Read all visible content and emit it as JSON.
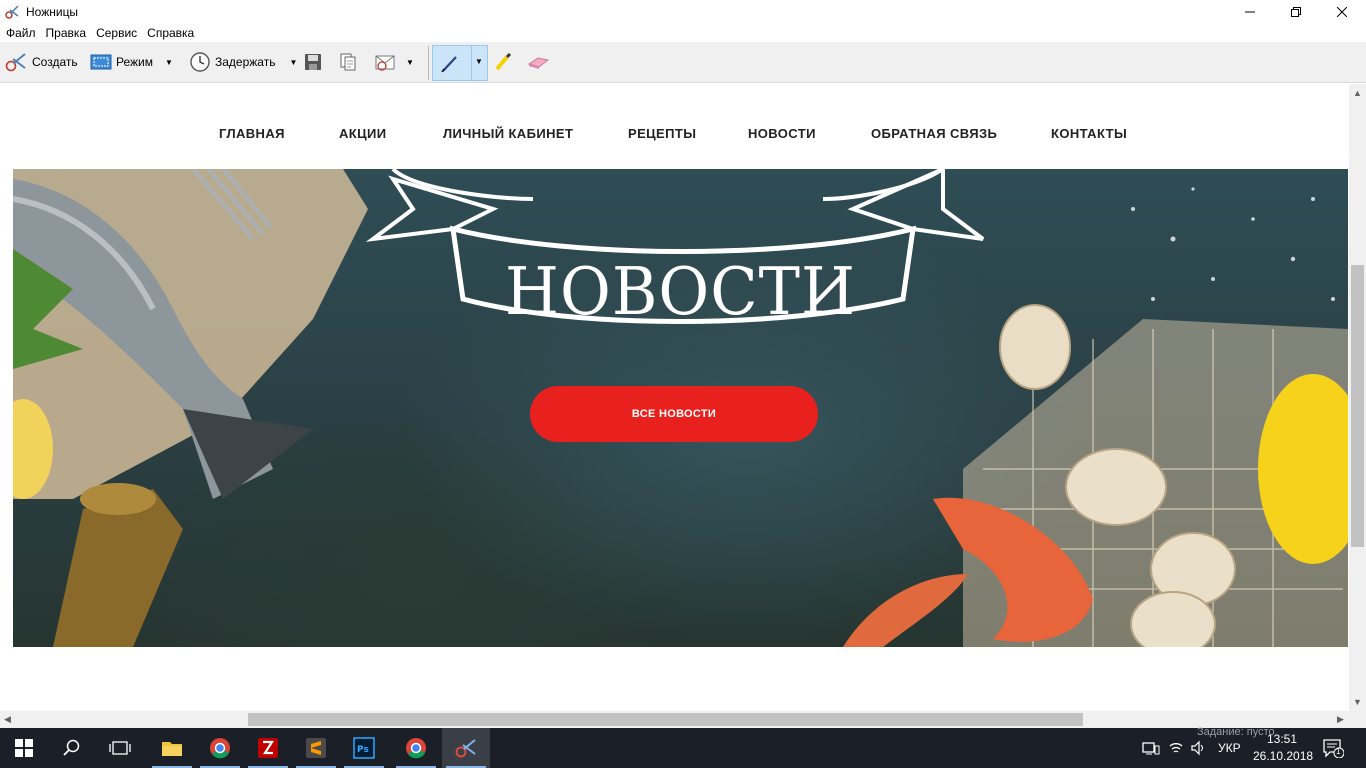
{
  "window": {
    "title": "Ножницы",
    "minimize_glyph": "—",
    "maximize_glyph": "☐",
    "close_glyph": "✕"
  },
  "menu": [
    "Файл",
    "Правка",
    "Сервис",
    "Справка"
  ],
  "toolbar": {
    "new_label": "Создать",
    "mode_label": "Режим",
    "delay_label": "Задержать",
    "dropdown_glyph": "▼"
  },
  "site": {
    "nav": [
      "ГЛАВНАЯ",
      "АКЦИИ",
      "ЛИЧНЫЙ КАБИНЕТ",
      "РЕЦЕПТЫ",
      "НОВОСТИ",
      "ОБРАТНАЯ СВЯЗЬ",
      "КОНТАКТЫ"
    ],
    "hero_title": "НОВОСТИ",
    "hero_button": "ВСЕ НОВОСТИ",
    "accent": "#e8211f"
  },
  "taskbar": {
    "apps": [
      "start-icon",
      "search-icon",
      "task-view-icon",
      "file-explorer-icon",
      "chrome-icon",
      "filezilla-icon",
      "sublime-text-icon",
      "photoshop-icon",
      "chrome-icon",
      "snipping-tool-icon"
    ],
    "status_text": "Задание: пусто",
    "language": "УКР",
    "time": "13:51",
    "date": "26.10.2018",
    "notifications": "1"
  }
}
